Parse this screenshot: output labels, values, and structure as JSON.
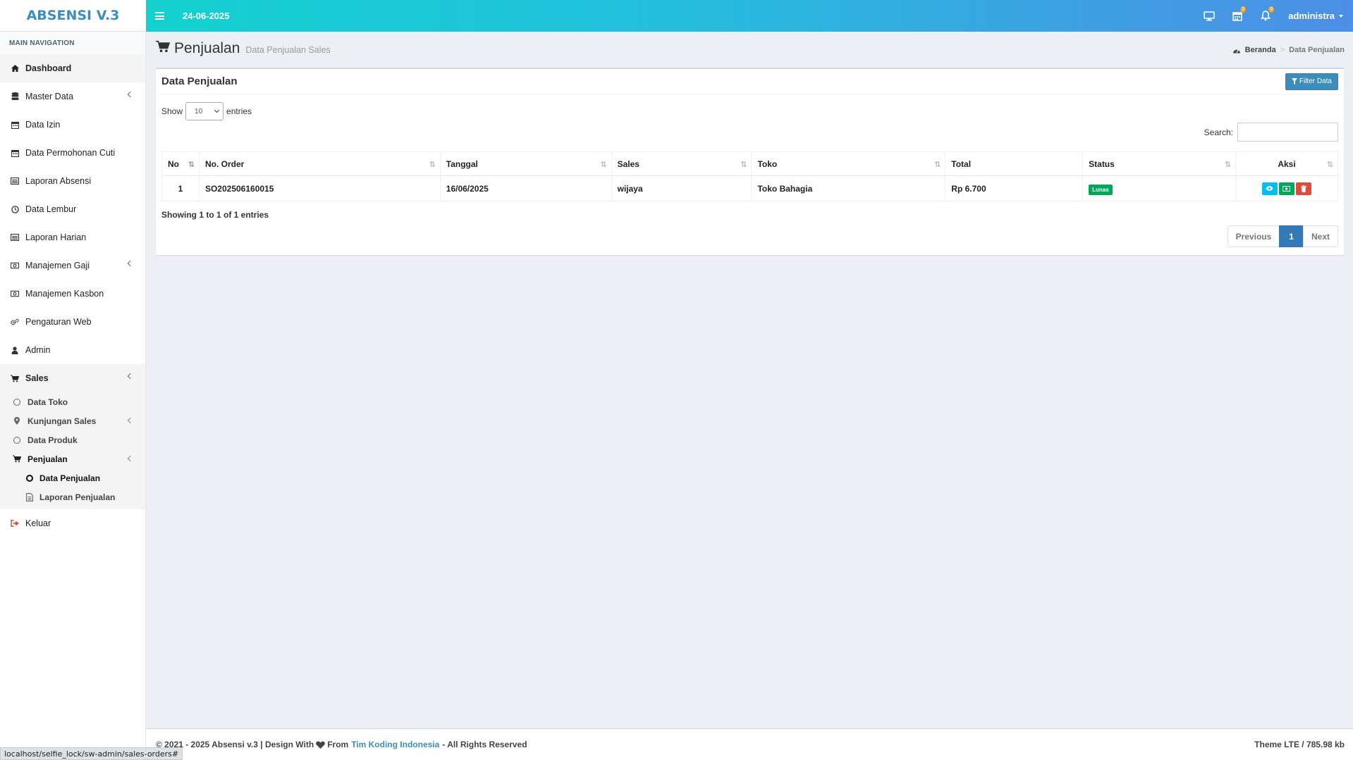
{
  "app": {
    "logo": "ABSENSI V.3"
  },
  "topbar": {
    "date": "24-06-2025",
    "calendar_badge": "2",
    "bell_badge": "0",
    "user": "administra"
  },
  "sidebar": {
    "header": "MAIN NAVIGATION",
    "items": [
      {
        "label": "Dashboard"
      },
      {
        "label": "Master Data"
      },
      {
        "label": "Data Izin"
      },
      {
        "label": "Data Permohonan Cuti"
      },
      {
        "label": "Laporan Absensi"
      },
      {
        "label": "Data Lembur"
      },
      {
        "label": "Laporan Harian"
      },
      {
        "label": "Manajemen Gaji"
      },
      {
        "label": "Manajemen Kasbon"
      },
      {
        "label": "Pengaturan Web"
      },
      {
        "label": "Admin"
      },
      {
        "label": "Sales"
      },
      {
        "label": "Keluar"
      }
    ],
    "sales_sub": [
      {
        "label": "Data Toko"
      },
      {
        "label": "Kunjungan Sales"
      },
      {
        "label": "Data Produk"
      },
      {
        "label": "Penjualan"
      }
    ],
    "penjualan_sub": [
      {
        "label": "Data Penjualan"
      },
      {
        "label": "Laporan Penjualan"
      }
    ]
  },
  "page": {
    "title": "Penjualan",
    "subtitle": "Data Penjualan Sales"
  },
  "breadcrumb": {
    "home": "Beranda",
    "sep": ">",
    "current": "Data Penjualan"
  },
  "box": {
    "title": "Data Penjualan",
    "filter_label": "Filter Data",
    "show_label": "Show",
    "show_value": "10",
    "entries_label": "entries",
    "search_label": "Search:",
    "search_value": ""
  },
  "table": {
    "headers": [
      "No",
      "No. Order",
      "Tanggal",
      "Sales",
      "Toko",
      "Total",
      "Status",
      "Aksi"
    ],
    "rows": [
      {
        "no": "1",
        "order": "SO202506160015",
        "tanggal": "16/06/2025",
        "sales": "wijaya",
        "toko": "Toko Bahagia",
        "total": "Rp 6.700",
        "status": "Lunas"
      }
    ],
    "info": "Showing 1 to 1 of 1 entries",
    "pager": {
      "prev": "Previous",
      "current": "1",
      "next": "Next"
    }
  },
  "footer": {
    "left_prefix": "© 2021 - 2025 Absensi v.3 | Design With",
    "left_from": "From",
    "link": "Tim Koding Indonesia",
    "left_suffix": "- All Rights Reserved",
    "right": "Theme LTE / 785.98 kb"
  },
  "statusbar": {
    "url": "localhost/selfie_lock/sw-admin/sales-orders#"
  },
  "colors": {
    "primary": "#3c8dbc",
    "success": "#00a65a",
    "info": "#00c0ef",
    "danger": "#dd4b39",
    "header_start": "#14d1cf",
    "header_end": "#4d8ee6"
  }
}
